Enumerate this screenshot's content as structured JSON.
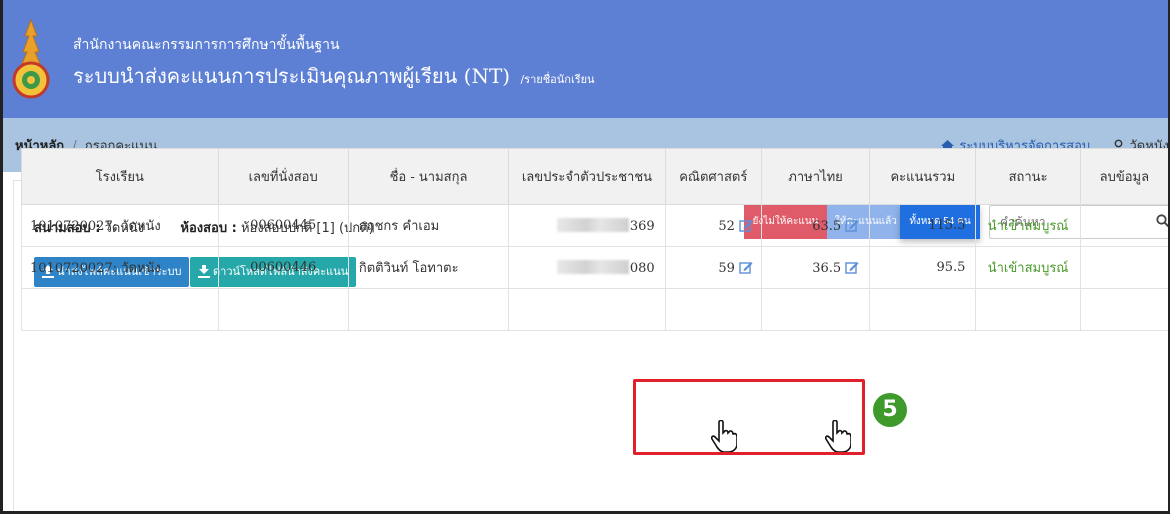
{
  "header": {
    "org_name": "สำนักงานคณะกรรมการการศึกษาขั้นพื้นฐาน",
    "title": "ระบบนำส่งคะแนนการประเมินคุณภาพผู้เรียน (NT)",
    "subtitle": "/รายชื่อนักเรียน",
    "header_color": "#5d7fd4"
  },
  "breadcrumb": {
    "home": "หน้าหลัก",
    "separator": "/",
    "current": "กรอกคะแนน"
  },
  "nav": {
    "exam_system_label": "ระบบบริหารจัดการสอบ",
    "user_label": "วัดหนัง"
  },
  "info": {
    "venue_label": "สนามสอบ :",
    "venue_value": "วัดหนัง",
    "room_label": "ห้องสอบ :",
    "room_value": "ห้องสอบปกติ [1] (ปกติ)"
  },
  "buttons": {
    "upload": "นำส่งไฟล์คะแนนเข้าระบบ",
    "download": "ดาวน์โหลดไฟล์นำส่งคะแนน"
  },
  "filters": {
    "not_scored": "ยังไม่ให้คะแนน",
    "scored": "ให้คะแนนแล้ว",
    "all": "ทั้งหมด 54 คน"
  },
  "search": {
    "placeholder": "คำค้นหา"
  },
  "table": {
    "headers": [
      "โรงเรียน",
      "เลขที่นั่งสอบ",
      "ชื่อ - นามสกุล",
      "เลขประจำตัวประชาชน",
      "คณิตศาสตร์",
      "ภาษาไทย",
      "คะแนนรวม",
      "สถานะ",
      "ลบข้อมูล"
    ],
    "rows": [
      {
        "school": "1010720027: วัดหนัง",
        "seat": "00600445",
        "name": "กฤชกร คำเอม",
        "cid_suffix": "369",
        "math": "52",
        "thai": "63.5",
        "total": "115.5",
        "status": "นำเข้าสมบูรณ์"
      },
      {
        "school": "1010720027: วัดหนัง",
        "seat": "00600446",
        "name": "กิตติวินท์ โอทาตะ",
        "cid_suffix": "080",
        "math": "59",
        "thai": "36.5",
        "total": "95.5",
        "status": "นำเข้าสมบูรณ์"
      }
    ]
  },
  "annotation": {
    "step_number": "5",
    "highlight_color": "#e0202a",
    "step_color": "#3f9a2c"
  }
}
